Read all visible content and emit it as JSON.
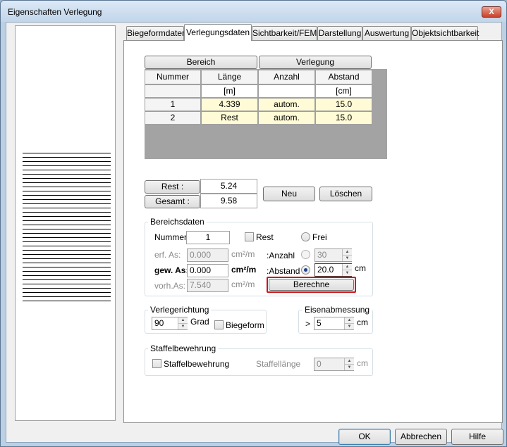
{
  "window": {
    "title": "Eigenschaften Verlegung",
    "close_label": "X"
  },
  "tabs": [
    {
      "label": "Biegeformdaten",
      "active": false
    },
    {
      "label": "Verlegungsdaten",
      "active": true
    },
    {
      "label": "Sichtbarkeit/FEM",
      "active": false
    },
    {
      "label": "Darstellung",
      "active": false
    },
    {
      "label": "Auswertung",
      "active": false
    },
    {
      "label": "Objektsichtbarkeit",
      "active": false
    }
  ],
  "table": {
    "group_headers": [
      "Bereich",
      "Verlegung"
    ],
    "columns": [
      "Nummer",
      "Länge",
      "Anzahl",
      "Abstand"
    ],
    "units": [
      "",
      "[m]",
      "",
      "[cm]"
    ],
    "rows": [
      {
        "nummer": "1",
        "laenge": "4.339",
        "anzahl": "autom.",
        "abstand": "15.0"
      },
      {
        "nummer": "2",
        "laenge": "Rest",
        "anzahl": "autom.",
        "abstand": "15.0"
      }
    ]
  },
  "summary": {
    "rest_label": "Rest :",
    "rest_value": "5.24",
    "gesamt_label": "Gesamt :",
    "gesamt_value": "9.58"
  },
  "actions": {
    "neu": "Neu",
    "loeschen": "Löschen"
  },
  "bereichsdaten": {
    "title": "Bereichsdaten",
    "nummer_label": "Nummer:",
    "nummer_value": "1",
    "rest_label": "Rest",
    "frei_label": "Frei",
    "erf_label": "erf. As:",
    "erf_value": "0.000",
    "erf_unit": "cm²/m",
    "gew_label": "gew. As:",
    "gew_value": "0.000",
    "gew_unit": "cm²/m",
    "vorh_label": "vorh.As:",
    "vorh_value": "7.540",
    "vorh_unit": "cm²/m",
    "anzahl_label": ":Anzahl",
    "anzahl_value": "30",
    "abstand_label": ":Abstand",
    "abstand_value": "20.0",
    "abstand_unit": "cm",
    "berechne_label": "Berechne"
  },
  "verlegerichtung": {
    "title": "Verlegerichtung",
    "value": "90",
    "unit": "Grad",
    "biegeform_label": "Biegeform"
  },
  "eisenabmessung": {
    "title": "Eisenabmessung",
    "prefix": ">",
    "value": "5",
    "unit": "cm"
  },
  "staffel": {
    "title": "Staffelbewehrung",
    "checkbox_label": "Staffelbewehrung",
    "laenge_label": "Staffellänge",
    "laenge_value": "0",
    "unit": "cm"
  },
  "footer": {
    "ok": "OK",
    "abbrechen": "Abbrechen",
    "hilfe": "Hilfe"
  },
  "colors": {
    "highlight_border": "#d0141c",
    "cell_yellow": "#fffbd6",
    "table_grey": "#a3a3a3"
  }
}
